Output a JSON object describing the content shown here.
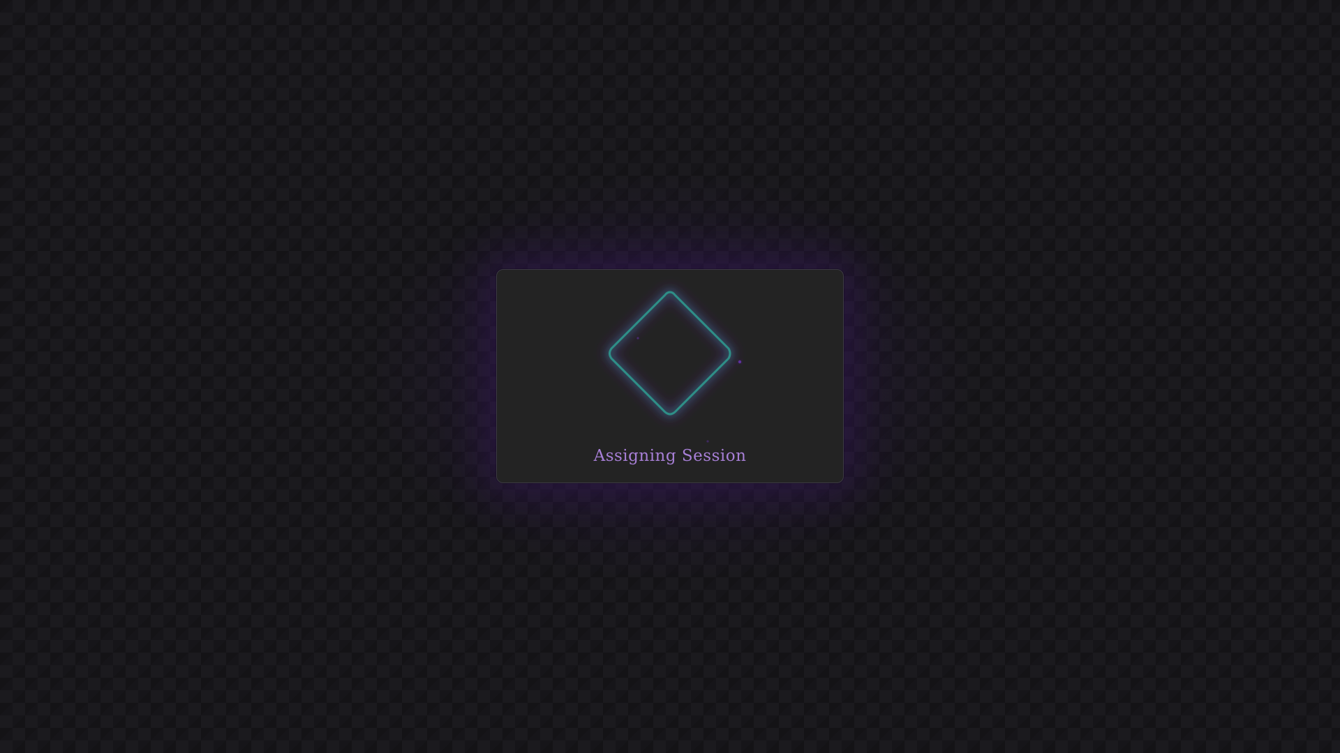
{
  "loader": {
    "status_text": "Assigning Session",
    "icon": "diamond-spinner-icon"
  },
  "colors": {
    "background": "#161519",
    "card_background": "#232323",
    "diamond_stroke": "#2f8f88",
    "glow": "#6a34b8",
    "status_text": "#a77fd6"
  }
}
